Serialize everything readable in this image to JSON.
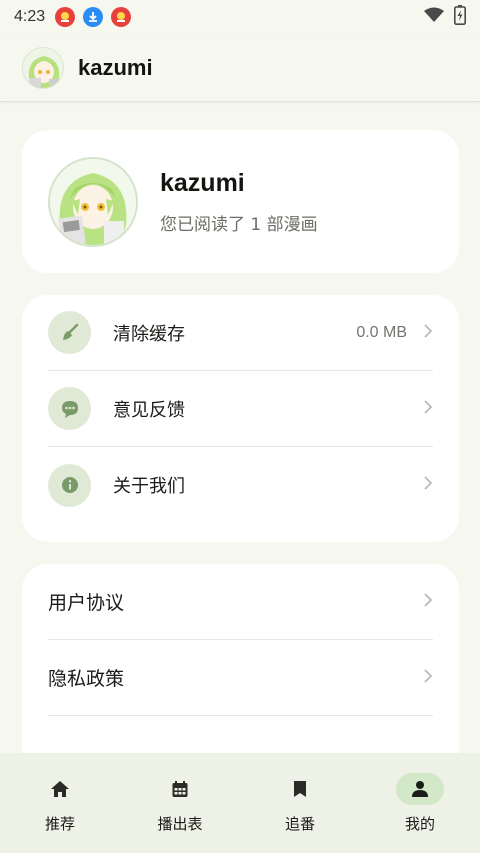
{
  "status_bar": {
    "time": "4:23",
    "notifications": [
      "app-badge-icon",
      "download-icon",
      "app-badge-icon"
    ],
    "icons": [
      "wifi-icon",
      "battery-charging-icon"
    ]
  },
  "app_bar": {
    "title": "kazumi"
  },
  "profile": {
    "name": "kazumi",
    "subtitle": "您已阅读了 1 部漫画"
  },
  "settings": [
    {
      "label": "清除缓存",
      "value": "0.0 MB",
      "icon": "broom-icon"
    },
    {
      "label": "意见反馈",
      "value": "",
      "icon": "feedback-icon"
    },
    {
      "label": "关于我们",
      "value": "",
      "icon": "info-icon"
    }
  ],
  "legal": [
    {
      "label": "用户协议"
    },
    {
      "label": "隐私政策"
    }
  ],
  "bottom_nav": [
    {
      "label": "推荐",
      "icon": "home-icon",
      "active": false
    },
    {
      "label": "播出表",
      "icon": "calendar-icon",
      "active": false
    },
    {
      "label": "追番",
      "icon": "bookmark-icon",
      "active": false
    },
    {
      "label": "我的",
      "icon": "person-icon",
      "active": true
    }
  ],
  "colors": {
    "background": "#f6f8f0",
    "card": "#ffffff",
    "icon_circle": "#dfe9d5",
    "nav_active": "#d3e8c8",
    "accent_green": "#7a9a6a"
  }
}
